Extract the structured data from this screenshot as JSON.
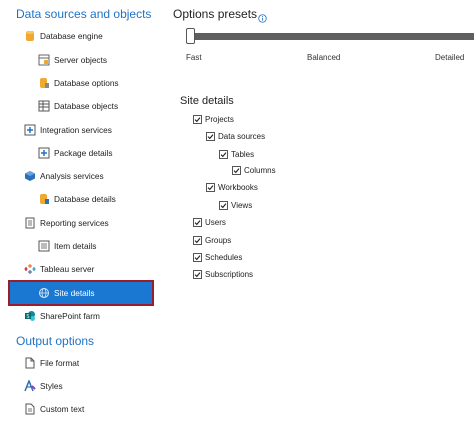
{
  "left_panel": {
    "data_sources_title": "Data sources and objects",
    "items": [
      {
        "label": "Database engine",
        "icon": "database-engine-icon"
      },
      {
        "label": "Server objects",
        "icon": "server-objects-icon"
      },
      {
        "label": "Database options",
        "icon": "database-options-icon"
      },
      {
        "label": "Database objects",
        "icon": "database-objects-icon"
      },
      {
        "label": "Integration services",
        "icon": "integration-services-icon"
      },
      {
        "label": "Package details",
        "icon": "package-details-icon"
      },
      {
        "label": "Analysis services",
        "icon": "analysis-services-icon"
      },
      {
        "label": "Database details",
        "icon": "database-details-icon"
      },
      {
        "label": "Reporting services",
        "icon": "reporting-services-icon"
      },
      {
        "label": "Item details",
        "icon": "item-details-icon"
      },
      {
        "label": "Tableau server",
        "icon": "tableau-server-icon"
      },
      {
        "label": "Site details",
        "icon": "site-details-icon"
      },
      {
        "label": "SharePoint farm",
        "icon": "sharepoint-farm-icon"
      }
    ],
    "output_title": "Output options",
    "output_items": [
      {
        "label": "File format",
        "icon": "file-format-icon"
      },
      {
        "label": "Styles",
        "icon": "styles-icon"
      },
      {
        "label": "Custom text",
        "icon": "custom-text-icon"
      }
    ]
  },
  "presets": {
    "title": "Options presets",
    "labels": [
      "Fast",
      "Balanced",
      "Detailed"
    ],
    "slider_value": 0
  },
  "site_details": {
    "title": "Site details",
    "options": [
      {
        "label": "Projects",
        "checked": true
      },
      {
        "label": "Data sources",
        "checked": true
      },
      {
        "label": "Tables",
        "checked": true
      },
      {
        "label": "Columns",
        "checked": true
      },
      {
        "label": "Workbooks",
        "checked": true
      },
      {
        "label": "Views",
        "checked": true
      },
      {
        "label": "Users",
        "checked": true
      },
      {
        "label": "Groups",
        "checked": true
      },
      {
        "label": "Schedules",
        "checked": true
      },
      {
        "label": "Subscriptions",
        "checked": true
      }
    ]
  },
  "colors": {
    "accent": "#1e73c8",
    "selected_bg": "#1a78d2",
    "selected_border": "#9b1c2c",
    "slider_track": "#5f5f5f"
  }
}
